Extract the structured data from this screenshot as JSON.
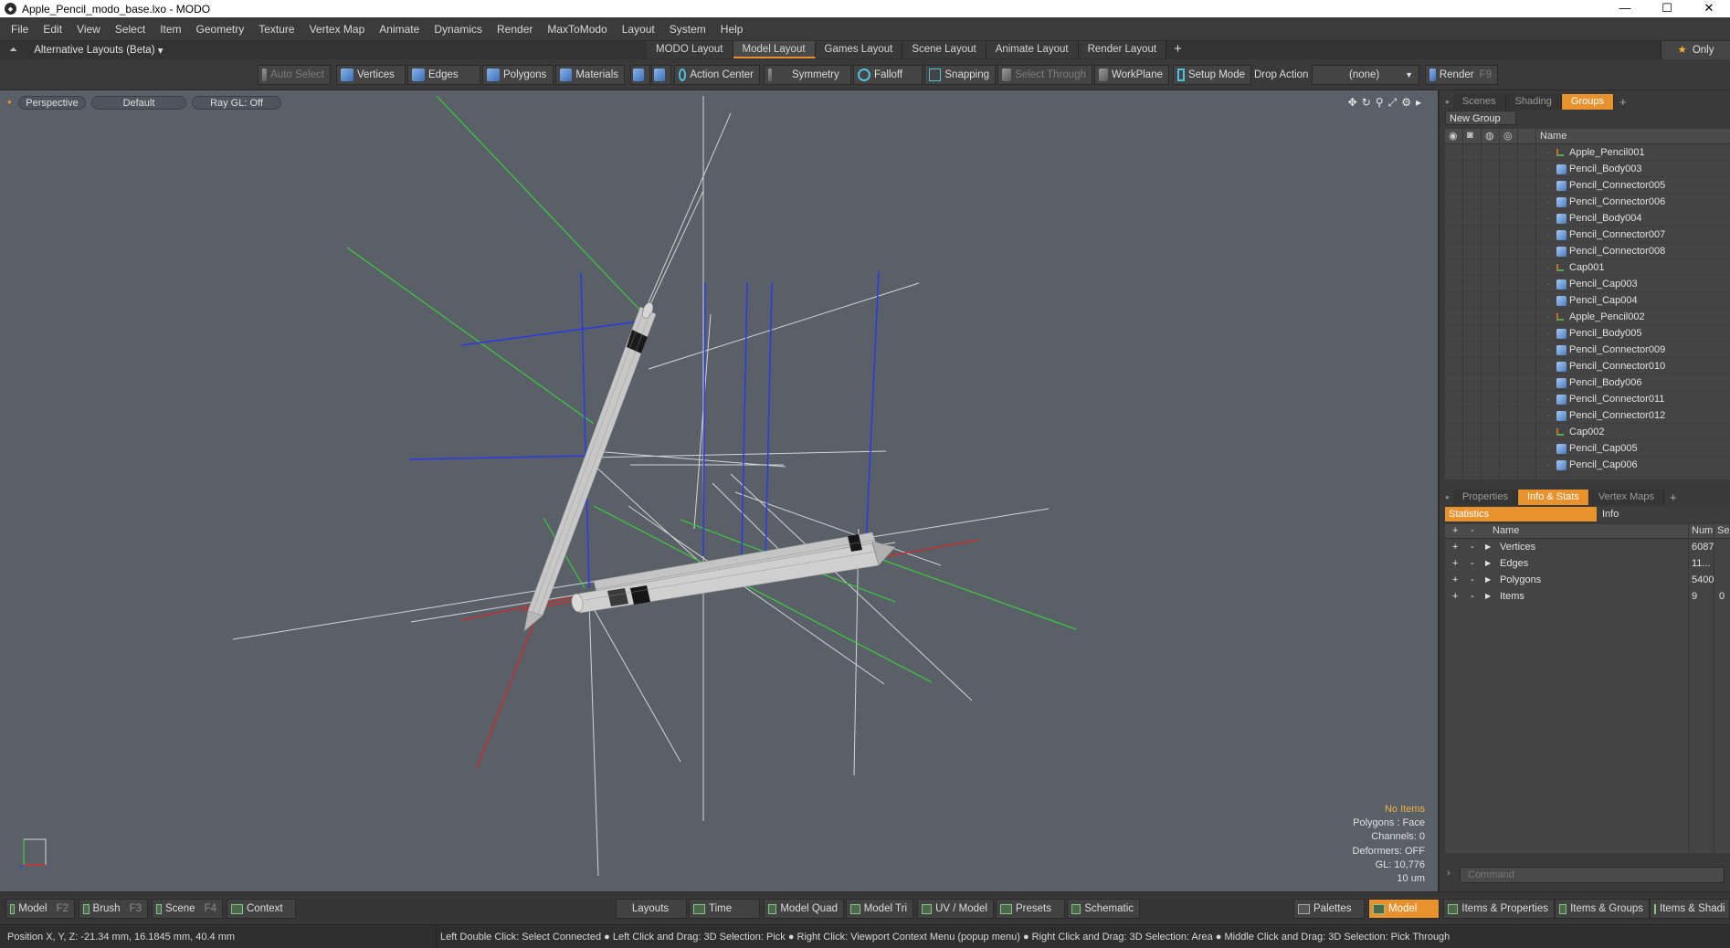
{
  "window": {
    "title": "Apple_Pencil_modo_base.lxo - MODO",
    "controls": [
      "—",
      "☐",
      "✕"
    ]
  },
  "menu": [
    "File",
    "Edit",
    "View",
    "Select",
    "Item",
    "Geometry",
    "Texture",
    "Vertex Map",
    "Animate",
    "Dynamics",
    "Render",
    "MaxToModo",
    "Layout",
    "System",
    "Help"
  ],
  "layout_bar": {
    "alt_layouts": "Alternative Layouts (Beta)",
    "tabs": [
      "MODO Layout",
      "Model Layout",
      "Games Layout",
      "Scene Layout",
      "Animate Layout",
      "Render Layout"
    ],
    "active_tab": "Model Layout",
    "only": "Only"
  },
  "toolbar": {
    "auto_select": "Auto Select",
    "vertices": "Vertices",
    "edges": "Edges",
    "polygons": "Polygons",
    "materials": "Materials",
    "action_center": "Action Center",
    "symmetry": "Symmetry",
    "falloff": "Falloff",
    "snapping": "Snapping",
    "select_through": "Select Through",
    "workplane": "WorkPlane",
    "setup_mode": "Setup Mode",
    "drop_action": "Drop Action",
    "drop_value": "(none)",
    "render": "Render",
    "render_key": "F9"
  },
  "viewport": {
    "view": "Perspective",
    "shading": "Default",
    "raygl": "Ray GL: Off",
    "info": {
      "no_items": "No Items",
      "polygons": "Polygons : Face",
      "channels": "Channels: 0",
      "deformers": "Deformers: OFF",
      "gl": "GL: 10,776",
      "unit": "10 um"
    }
  },
  "groups_panel": {
    "tabs": [
      "Scenes",
      "Shading",
      "Groups"
    ],
    "active": "Groups",
    "new_group": "New Group",
    "column_name": "Name",
    "items": [
      {
        "name": "Apple_Pencil001",
        "type": "locator"
      },
      {
        "name": "Pencil_Body003",
        "type": "mesh"
      },
      {
        "name": "Pencil_Connector005",
        "type": "mesh"
      },
      {
        "name": "Pencil_Connector006",
        "type": "mesh"
      },
      {
        "name": "Pencil_Body004",
        "type": "mesh"
      },
      {
        "name": "Pencil_Connector007",
        "type": "mesh"
      },
      {
        "name": "Pencil_Connector008",
        "type": "mesh"
      },
      {
        "name": "Cap001",
        "type": "locator"
      },
      {
        "name": "Pencil_Cap003",
        "type": "mesh"
      },
      {
        "name": "Pencil_Cap004",
        "type": "mesh"
      },
      {
        "name": "Apple_Pencil002",
        "type": "locator"
      },
      {
        "name": "Pencil_Body005",
        "type": "mesh"
      },
      {
        "name": "Pencil_Connector009",
        "type": "mesh"
      },
      {
        "name": "Pencil_Connector010",
        "type": "mesh"
      },
      {
        "name": "Pencil_Body006",
        "type": "mesh"
      },
      {
        "name": "Pencil_Connector011",
        "type": "mesh"
      },
      {
        "name": "Pencil_Connector012",
        "type": "mesh"
      },
      {
        "name": "Cap002",
        "type": "locator"
      },
      {
        "name": "Pencil_Cap005",
        "type": "mesh"
      },
      {
        "name": "Pencil_Cap006",
        "type": "mesh"
      }
    ]
  },
  "stats_panel": {
    "tabs": [
      "Properties",
      "Info & Stats",
      "Vertex Maps"
    ],
    "active": "Info & Stats",
    "subtabs": [
      "Statistics",
      "Info"
    ],
    "columns": {
      "name": "Name",
      "num": "Num",
      "sel": "Sel"
    },
    "rows": [
      {
        "name": "Vertices",
        "num": "6087",
        "sel": ""
      },
      {
        "name": "Edges",
        "num": "11...",
        "sel": ""
      },
      {
        "name": "Polygons",
        "num": "5400",
        "sel": ""
      },
      {
        "name": "Items",
        "num": "9",
        "sel": "0"
      }
    ],
    "command_placeholder": "Command"
  },
  "bottom_bar": {
    "model": "Model",
    "model_key": "F2",
    "brush": "Brush",
    "brush_key": "F3",
    "scene": "Scene",
    "scene_key": "F4",
    "context": "Context",
    "layouts": "Layouts",
    "time": "Time",
    "model_quad": "Model Quad",
    "model_tri": "Model Tri",
    "uv_model": "UV / Model",
    "presets": "Presets",
    "schematic": "Schematic",
    "palettes": "Palettes",
    "model_active": "Model",
    "items_properties": "Items & Properties",
    "items_groups": "Items & Groups",
    "items_shading": "Items & Shadi"
  },
  "status": {
    "position": "Position X, Y, Z:   -21.34 mm, 16.1845 mm, 40.4 mm",
    "hint": "Left Double Click: Select Connected ● Left Click and Drag: 3D Selection: Pick ● Right Click: Viewport Context Menu (popup menu) ● Right Click and Drag: 3D Selection: Area ● Middle Click and Drag: 3D Selection: Pick Through"
  }
}
